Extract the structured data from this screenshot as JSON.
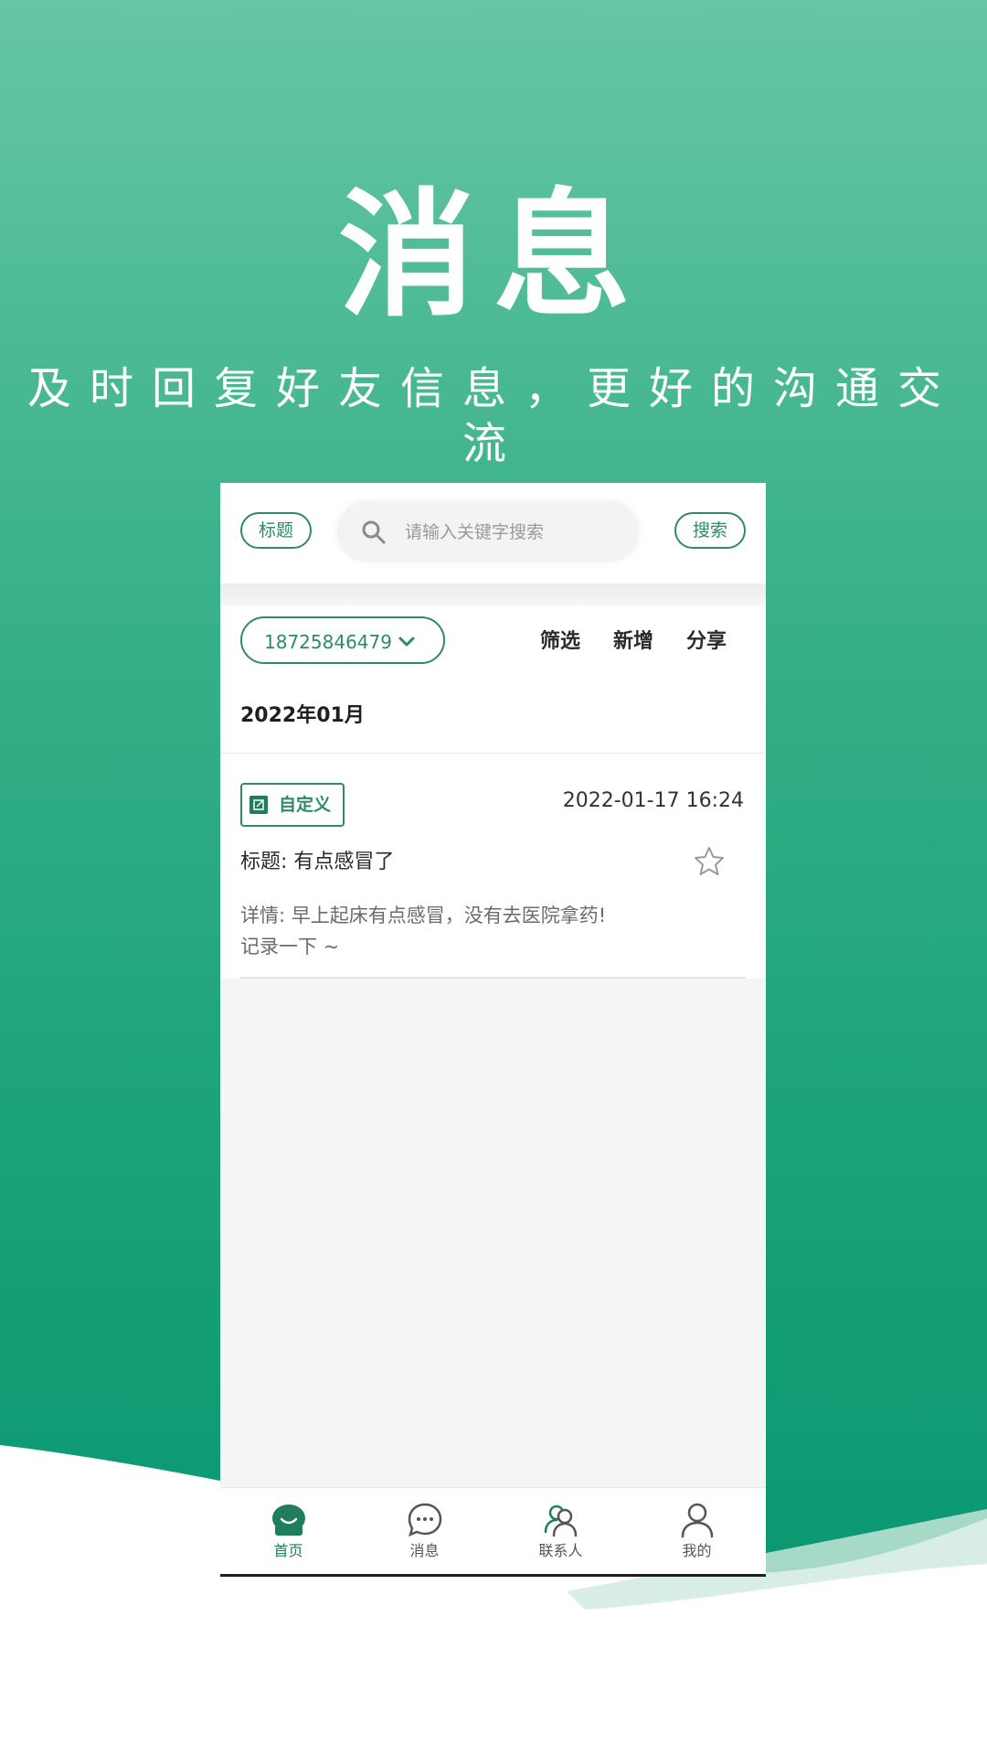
{
  "hero": {
    "title": "消息",
    "subtitle": "及时回复好友信息，更好的沟通交流"
  },
  "search": {
    "title_button": "标题",
    "placeholder": "请输入关键字搜索",
    "search_button": "搜索"
  },
  "filter": {
    "phone": "18725846479",
    "actions": {
      "filter": "筛选",
      "add": "新增",
      "share": "分享"
    }
  },
  "month": "2022年01月",
  "entry": {
    "tag": "自定义",
    "datetime": "2022-01-17 16:24",
    "title": "标题:  有点感冒了",
    "detail": "详情:  早上起床有点感冒，没有去医院拿药!\n记录一下 ~"
  },
  "tabbar": {
    "items": [
      {
        "label": "首页",
        "icon": "home-icon",
        "active": true
      },
      {
        "label": "消息",
        "icon": "message-icon",
        "active": false
      },
      {
        "label": "联系人",
        "icon": "contacts-icon",
        "active": false
      },
      {
        "label": "我的",
        "icon": "profile-icon",
        "active": false
      }
    ]
  },
  "colors": {
    "accent": "#2f8a69",
    "background_top": "#66c6a5",
    "background_bottom": "#0a956d"
  }
}
